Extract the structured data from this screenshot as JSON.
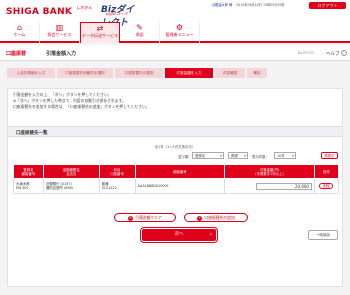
{
  "header": {
    "logo": "SHIGA BANK",
    "brand_small": "しがぎん",
    "brand_main": "Bizダイレクト",
    "brand_sub": "Lightコース",
    "user_name": "近銀建太郎 様",
    "last_login": "2014年06月18日 10時05分05秒",
    "logout_label": "ログアウト"
  },
  "nav": [
    {
      "icon": "home-icon",
      "glyph": "⌂",
      "label": "ホーム"
    },
    {
      "icon": "building-icon",
      "glyph": "▥",
      "label": "照会サービス"
    },
    {
      "icon": "transfer-icon",
      "glyph": "⇄",
      "label": "データ伝送サービス"
    },
    {
      "icon": "approval-icon",
      "glyph": "✎",
      "label": "承認"
    },
    {
      "icon": "settings-icon",
      "glyph": "⚙",
      "label": "管理者メニュー"
    }
  ],
  "page": {
    "category": "口座振替",
    "title": "引落金額入力",
    "screen_code": "BKZF009",
    "help_label": "ヘルプ",
    "help_glyph": "?"
  },
  "steps": [
    "入金先情報を入力",
    "口座振替先依頼先を選択",
    "口座振替先を選択",
    "引落金額を入力",
    "内容確認",
    "確定"
  ],
  "notes": [
    "引落金額を入力の上、「次へ」ボタンを押してください。",
    "※「次へ」ボタンを押した時点で、内容の自動引き保存されます。",
    "口座振替先を追加する場合は、「口座振替先の追加」ボタンを押してください。"
  ],
  "section_title": "口座振替先一覧",
  "list": {
    "count_text": "全1件（1〜1件を表示中）",
    "sort_label": "並び順：",
    "sort_value": "登録名",
    "order_value": "昇順",
    "perpage_label": "表示件数：",
    "perpage_value": "10件",
    "redisplay_label": "再表示",
    "columns": [
      "登録名\n顧客番号",
      "金融機関名\n支店名",
      "科目\n口座番号",
      "顧客番号",
      "引落金額(円)\n(半角数字1桁以上)",
      "操作"
    ],
    "rows": [
      {
        "name": "大津太郎",
        "customer_no": "EM 001",
        "bank": "近銀銀行 (0157)",
        "branch": "瀬田出張所 (898)",
        "account_type": "普通",
        "account_no": "0121222",
        "client_no": "AAA1888D010001",
        "amount": "20,000",
        "action": "削除"
      }
    ]
  },
  "buttons": {
    "clear": "引落金額クリア",
    "add": "口座振替先の追加",
    "next": "次へ",
    "save": "一時保存"
  }
}
